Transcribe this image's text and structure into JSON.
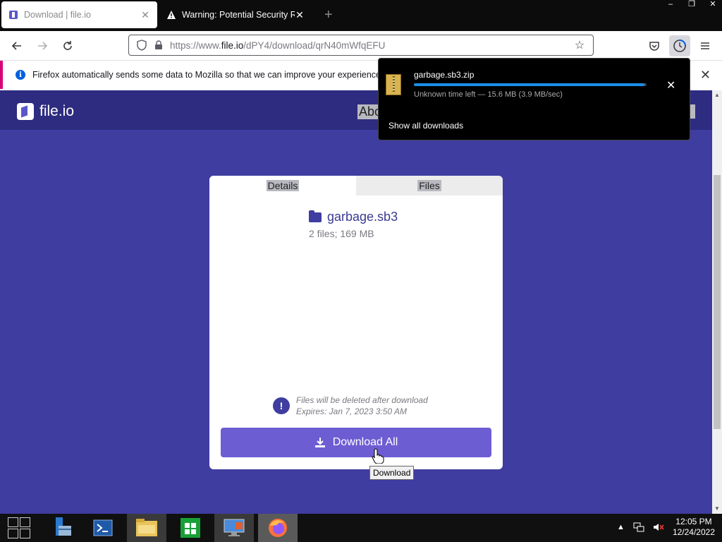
{
  "browser": {
    "tabs": [
      {
        "title": "Download | file.io",
        "active": true
      },
      {
        "title": "Warning: Potential Security Risk",
        "active": false
      }
    ],
    "url_prefix": "https://www.",
    "url_domain": "file.io",
    "url_path": "/dPY4/download/qrN40mWfqEFU",
    "window_controls": {
      "minimize": "–",
      "restore": "❐",
      "close": "✕"
    }
  },
  "notification": {
    "text": "Firefox automatically sends some data to Mozilla so that we can improve your experience."
  },
  "downloads_panel": {
    "filename": "garbage.sb3.zip",
    "status": "Unknown time left — 15.6 MB (3.9 MB/sec)",
    "show_all": "Show all downloads",
    "progress_fraction": 0.99
  },
  "site": {
    "logo_text": "file.io",
    "nav_about": "Abo",
    "tabs": {
      "details": "Details",
      "files": "Files"
    },
    "file_name": "garbage.sb3",
    "file_info": "2 files; 169 MB",
    "warning_line1": "Files will be deleted after download",
    "warning_line2": "Expires: Jan 7, 2023 3:50 AM",
    "download_button": "Download All",
    "tooltip": "Download"
  },
  "taskbar": {
    "time": "12:05 PM",
    "date": "12/24/2022"
  },
  "colors": {
    "page_bg": "#3f3da0",
    "header_bg": "#2e2c80",
    "button_bg": "#6c5dd3",
    "progress": "#1a8fe8"
  }
}
